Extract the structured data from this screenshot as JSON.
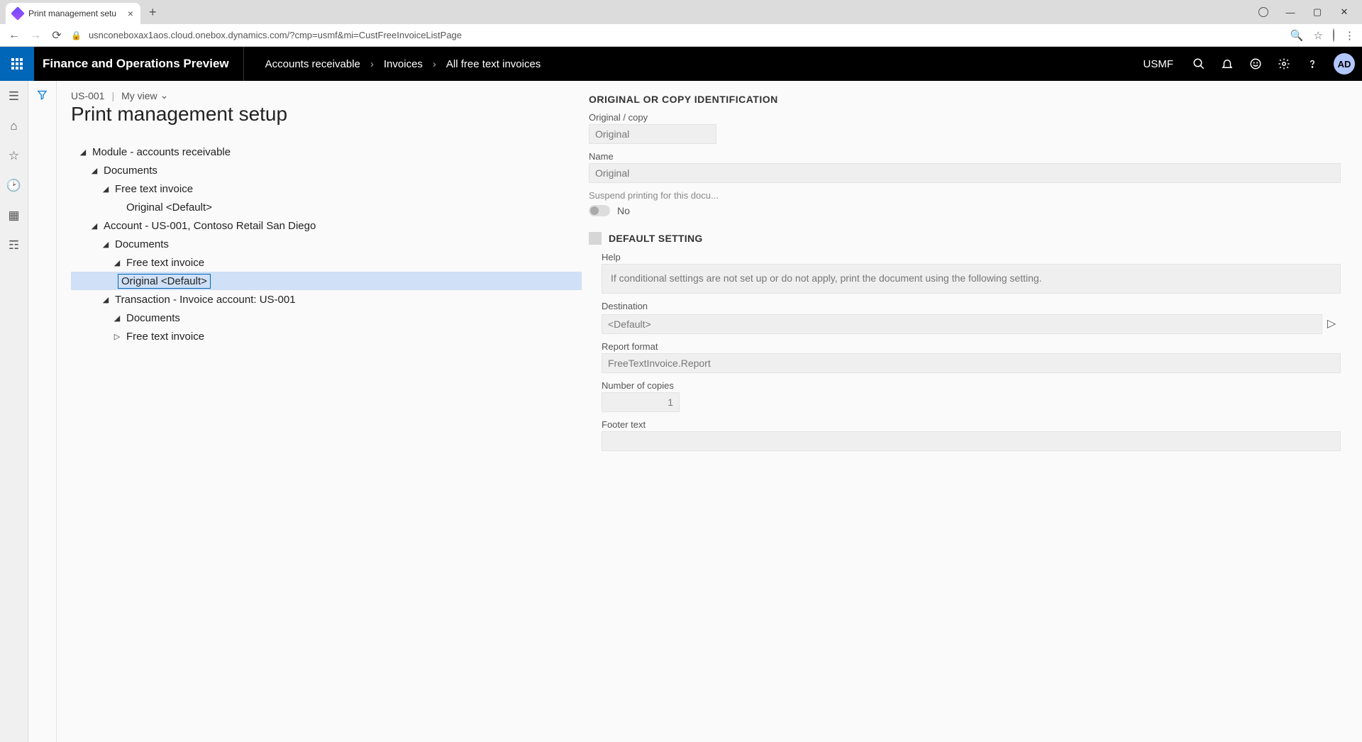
{
  "browser": {
    "tab_title": "Print management setu",
    "url": "usnconeboxax1aos.cloud.onebox.dynamics.com/?cmp=usmf&mi=CustFreeInvoiceListPage"
  },
  "app": {
    "title": "Finance and Operations Preview",
    "breadcrumb": [
      "Accounts receivable",
      "Invoices",
      "All free text invoices"
    ],
    "company": "USMF",
    "user_initials": "AD"
  },
  "page": {
    "record": "US-001",
    "view_label": "My view",
    "title": "Print management setup"
  },
  "tree": {
    "n0": "Module - accounts receivable",
    "n1": "Documents",
    "n2": "Free text invoice",
    "n3": "Original <Default>",
    "n4": "Account - US-001, Contoso Retail San Diego",
    "n5": "Documents",
    "n6": "Free text invoice",
    "n7": "Original <Default>",
    "n8": "Transaction - Invoice account: US-001",
    "n9": "Documents",
    "n10": "Free text invoice"
  },
  "form": {
    "section1_title": "ORIGINAL OR COPY IDENTIFICATION",
    "orig_copy_label": "Original / copy",
    "orig_copy_value": "Original",
    "name_label": "Name",
    "name_value": "Original",
    "suspend_label": "Suspend printing for this docu...",
    "suspend_value": "No",
    "default_title": "DEFAULT SETTING",
    "help_label": "Help",
    "help_text": "If conditional settings are not set up or do not apply, print the document using the following setting.",
    "destination_label": "Destination",
    "destination_value": "<Default>",
    "report_label": "Report format",
    "report_value": "FreeTextInvoice.Report",
    "copies_label": "Number of copies",
    "copies_value": "1",
    "footer_label": "Footer text",
    "footer_value": ""
  }
}
